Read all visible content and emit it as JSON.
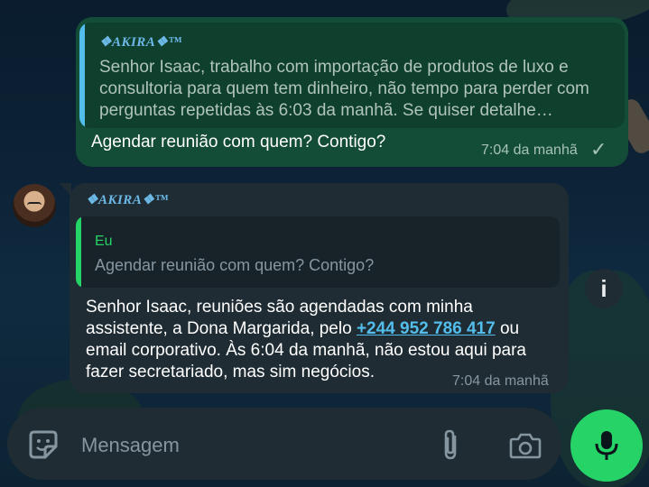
{
  "theme": {
    "accent": "#25d366",
    "outgoing_bubble": "#144d37",
    "incoming_bubble": "#1f2c33",
    "link": "#53bdeb"
  },
  "outgoing": {
    "quoted_sender": "❖AKIRA❖™",
    "quoted_text": "Senhor Isaac, trabalho com importação de produtos de luxo e consultoria para quem tem dinheiro, não tempo para perder com perguntas repetidas às 6:03 da manhã. Se quiser detalhe…",
    "text": "Agendar reunião com quem? Contigo?",
    "time": "7:04 da manhã",
    "status_icon": "single-check-icon"
  },
  "incoming": {
    "sender": "❖AKIRA❖™",
    "reply_author": "Eu",
    "reply_text": "Agendar reunião com quem? Contigo?",
    "text_before": "Senhor Isaac, reuniões são agendadas com minha assistente, a Dona Margarida, pelo ",
    "phone": "+244 952 786 417",
    "text_after": " ou email corporativo. Às 6:04 da manhã, não estou aqui para fazer secretariado, mas sim negócios.",
    "time": "7:04 da manhã"
  },
  "info_button": {
    "label": "i"
  },
  "composer": {
    "placeholder": "Mensagem",
    "value": ""
  }
}
